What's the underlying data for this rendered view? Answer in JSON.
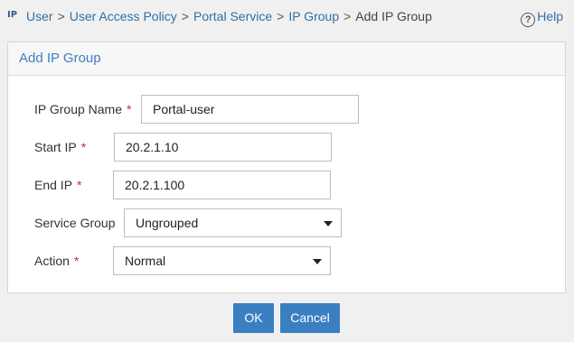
{
  "breadcrumb": {
    "icon": "ip-network-icon",
    "items": [
      "User",
      "User Access Policy",
      "Portal Service",
      "IP Group"
    ],
    "separator": ">",
    "current": "Add IP Group"
  },
  "help": {
    "label": "Help",
    "icon": "question-circle-icon"
  },
  "panel": {
    "title": "Add IP Group"
  },
  "form": {
    "required_mark": "*",
    "ip_group_name": {
      "label": "IP Group Name",
      "value": "Portal-user",
      "required": true
    },
    "start_ip": {
      "label": "Start IP",
      "value": "20.2.1.10",
      "required": true
    },
    "end_ip": {
      "label": "End IP",
      "value": "20.2.1.100",
      "required": true
    },
    "service_group": {
      "label": "Service Group",
      "value": "Ungrouped",
      "required": false
    },
    "action": {
      "label": "Action",
      "value": "Normal",
      "required": true
    }
  },
  "buttons": {
    "ok": "OK",
    "cancel": "Cancel"
  },
  "colors": {
    "accent": "#3a7fc1",
    "link": "#2f6ea8",
    "required": "#d9232d"
  }
}
